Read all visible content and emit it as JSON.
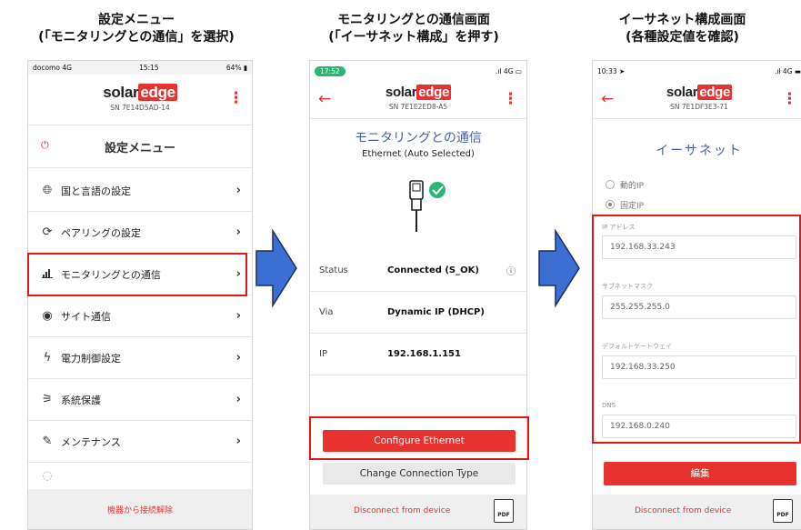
{
  "titles": {
    "col1_line1": "設定メニュー",
    "col1_line2": "(「モニタリングとの通信」を選択)",
    "col2_line1": "モニタリングとの通信画面",
    "col2_line2": "(「イーサネット構成」を押す)",
    "col3_line1": "イーサネット構成画面",
    "col3_line2": "(各種設定値を確認)"
  },
  "brand": {
    "solar": "solar",
    "edge": "edge"
  },
  "phone1": {
    "status_left": "docomo 4G",
    "status_time": "15:15",
    "status_battery": "64%",
    "serial": "SN 7E14D5AD-14",
    "menu_title": "設定メニュー",
    "items": [
      {
        "icon": "globe-icon",
        "label": "国と言語の設定"
      },
      {
        "icon": "pairing-icon",
        "label": "ペアリングの設定"
      },
      {
        "icon": "signal-bars-icon",
        "label": "モニタリングとの通信"
      },
      {
        "icon": "location-pin-icon",
        "label": "サイト通信"
      },
      {
        "icon": "lightning-icon",
        "label": "電力制御設定"
      },
      {
        "icon": "grid-tower-icon",
        "label": "系統保護"
      },
      {
        "icon": "wrench-icon",
        "label": "メンテナンス"
      }
    ],
    "footer": "機器から接続解除"
  },
  "phone2": {
    "status_time": "17:52",
    "status_network": "4G",
    "serial": "SN 7E1E2ED8-A5",
    "screen_title": "モニタリングとの通信",
    "subtitle": "Ethernet (Auto Selected)",
    "rows": [
      {
        "key": "Status",
        "value": "Connected (S_OK)"
      },
      {
        "key": "Via",
        "value": "Dynamic IP (DHCP)"
      },
      {
        "key": "IP",
        "value": "192.168.1.151"
      }
    ],
    "configure_button": "Configure Ethernet",
    "change_button": "Change Connection Type",
    "disconnect": "Disconnect from device",
    "pdf_label": "PDF"
  },
  "phone3": {
    "status_time": "10:33",
    "status_network": "4G",
    "serial": "SN 7E1DF3E3-71",
    "screen_title": "イーサネット",
    "radio_dynamic": "動的IP",
    "radio_static": "固定IP",
    "fields": [
      {
        "label": "IP アドレス",
        "value": "192.168.33.243"
      },
      {
        "label": "サブネットマスク",
        "value": "255.255.255.0"
      },
      {
        "label": "デフォルトゲートウェイ",
        "value": "192.168.33.250"
      },
      {
        "label": "DNS",
        "value": "192.168.0.240"
      }
    ],
    "edit_button": "編集",
    "disconnect": "Disconnect from device",
    "pdf_label": "PDF"
  },
  "colors": {
    "brand_red": "#e8322f",
    "highlight_red": "#e01818",
    "arrow_blue": "#3b6fd1",
    "check_green": "#2bb673"
  }
}
